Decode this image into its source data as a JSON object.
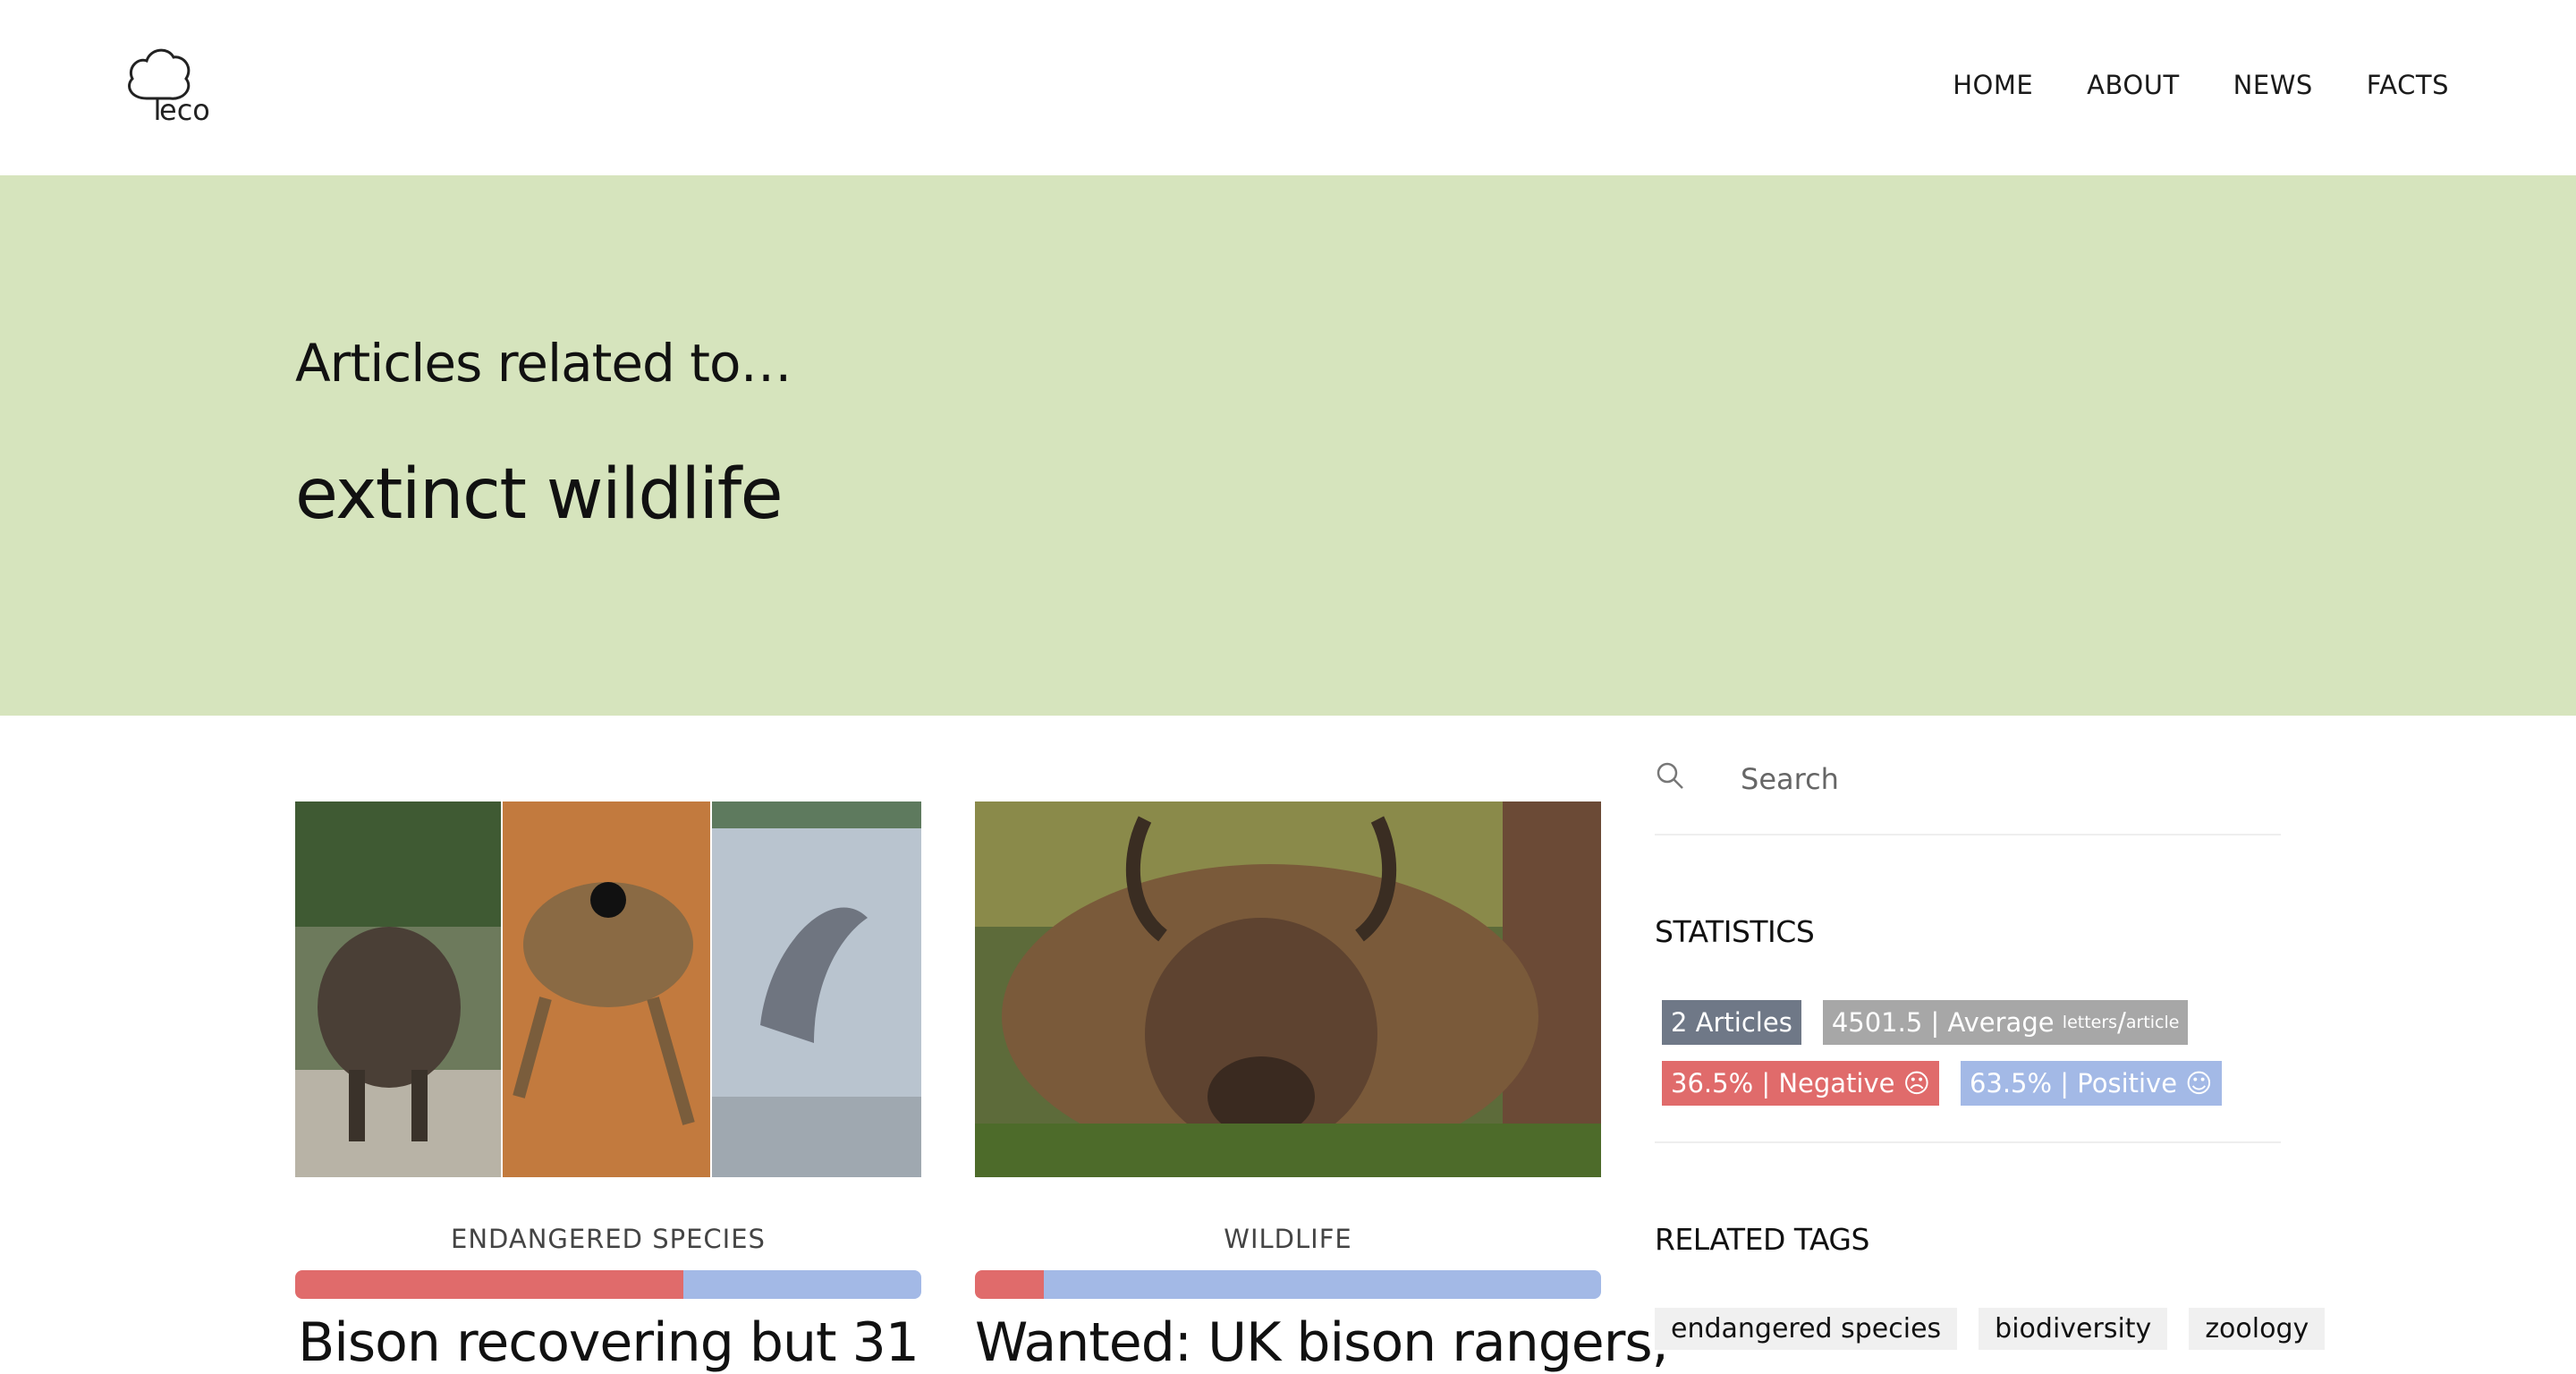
{
  "header": {
    "logo_text": "eco",
    "nav": [
      {
        "label": "HOME"
      },
      {
        "label": "ABOUT"
      },
      {
        "label": "NEWS"
      },
      {
        "label": "FACTS"
      }
    ]
  },
  "hero": {
    "subtitle": "Articles related to…",
    "title": "extinct wildlife"
  },
  "articles": [
    {
      "category": "ENDANGERED SPECIES",
      "negative_fraction": 0.62,
      "title": "Bison recovering but 31",
      "image": "bison-frog-dolphin-collage"
    },
    {
      "category": "WILDLIFE",
      "negative_fraction": 0.11,
      "title": "Wanted: UK bison rangers,",
      "image": "bison-lying-in-forest"
    }
  ],
  "search": {
    "placeholder": "Search"
  },
  "statistics": {
    "title": "STATISTICS",
    "articles": "2 Articles",
    "average_value": "4501.5 | Average ",
    "average_num": "letters",
    "average_den": "article",
    "negative": "36.5% | Negative",
    "positive": "63.5% | Positive"
  },
  "related_tags": {
    "title": "RELATED TAGS",
    "tags": [
      "endangered species",
      "biodiversity",
      "zoology"
    ]
  },
  "colors": {
    "hero_bg": "#d6e4bd",
    "negative": "#e06b6b",
    "positive": "#a3b9e6",
    "badge_dark": "#6f7887",
    "badge_gray": "#a7a7a7"
  }
}
